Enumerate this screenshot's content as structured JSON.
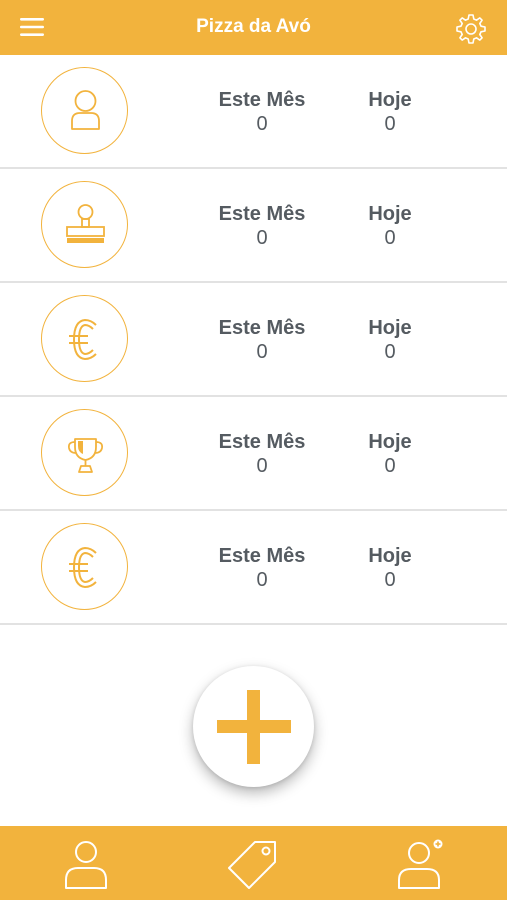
{
  "header": {
    "title": "Pizza da Avó"
  },
  "colors": {
    "accent": "#F2B33D",
    "text": "#555b61",
    "divider": "#e2e2e2"
  },
  "rows": [
    {
      "icon": "user-icon",
      "month_label": "Este Mês",
      "month_value": "0",
      "today_label": "Hoje",
      "today_value": "0"
    },
    {
      "icon": "stamp-icon",
      "month_label": "Este Mês",
      "month_value": "0",
      "today_label": "Hoje",
      "today_value": "0"
    },
    {
      "icon": "euro-icon",
      "month_label": "Este Mês",
      "month_value": "0",
      "today_label": "Hoje",
      "today_value": "0"
    },
    {
      "icon": "trophy-icon",
      "month_label": "Este Mês",
      "month_value": "0",
      "today_label": "Hoje",
      "today_value": "0"
    },
    {
      "icon": "euro-icon",
      "month_label": "Este Mês",
      "month_value": "0",
      "today_label": "Hoje",
      "today_value": "0"
    }
  ],
  "fab": {
    "icon": "plus-icon"
  },
  "tabbar": {
    "items": [
      "user-icon",
      "tag-icon",
      "add-user-icon"
    ]
  }
}
